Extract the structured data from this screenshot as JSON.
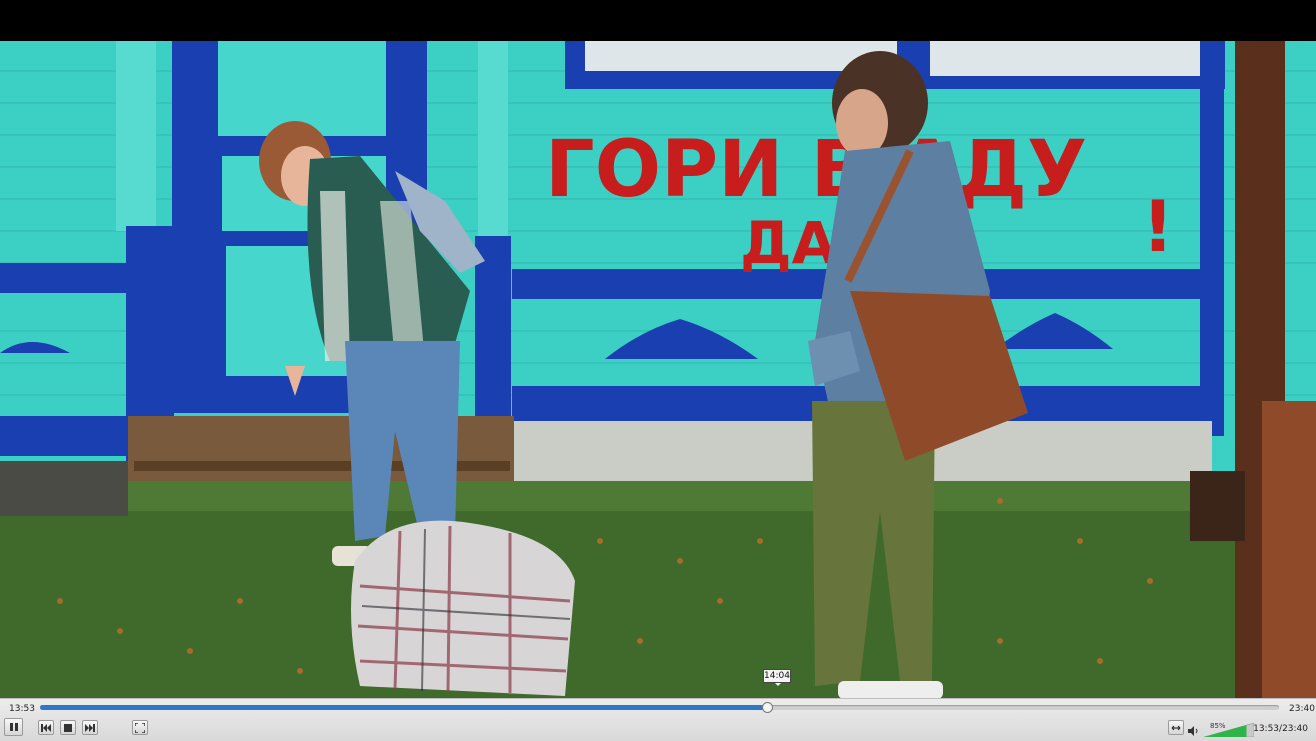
{
  "player": {
    "elapsed": "13:53",
    "duration": "23:40",
    "hover_time": "14:04",
    "progress_fraction": 0.5866,
    "volume": "85%",
    "volume_fraction": 0.85,
    "time_readout": "13:53/23:40"
  },
  "scene": {
    "graffiti_line1": "ГОРИ В АДУ",
    "graffiti_line2": "ДАЧКА",
    "graffiti_mark": "!"
  },
  "icons": {
    "pause": "pause-icon",
    "previous": "skip-previous-icon",
    "stop": "stop-icon",
    "next": "skip-next-icon",
    "fullscreen": "fullscreen-icon",
    "loop": "loop-icon",
    "volume": "speaker-icon"
  },
  "colors": {
    "progress_fill": "#2f77c7",
    "volume_fill": "#2fb44a",
    "wall": "#35d1c6",
    "trim": "#1a3fb0",
    "graffiti": "#c81d1d"
  }
}
